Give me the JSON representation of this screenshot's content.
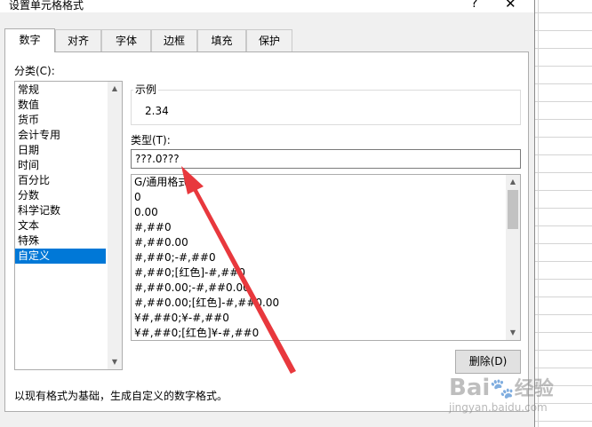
{
  "dialog": {
    "title": "设置单元格格式",
    "help_glyph": "?",
    "close_glyph": "✕"
  },
  "tabs": [
    {
      "label": "数字",
      "active": true
    },
    {
      "label": "对齐",
      "active": false
    },
    {
      "label": "字体",
      "active": false
    },
    {
      "label": "边框",
      "active": false
    },
    {
      "label": "填充",
      "active": false
    },
    {
      "label": "保护",
      "active": false
    }
  ],
  "category": {
    "label": "分类(C):",
    "items": [
      "常规",
      "数值",
      "货币",
      "会计专用",
      "日期",
      "时间",
      "百分比",
      "分数",
      "科学记数",
      "文本",
      "特殊",
      "自定义"
    ],
    "selected": "自定义"
  },
  "sample": {
    "label": "示例",
    "value": "2.34"
  },
  "type": {
    "label": "类型(T):",
    "value": "???.0???",
    "list": [
      "G/通用格式",
      "0",
      "0.00",
      "#,##0",
      "#,##0.00",
      "#,##0;-#,##0",
      "#,##0;[红色]-#,##0",
      "#,##0.00;-#,##0.00",
      "#,##0.00;[红色]-#,##0.00",
      "¥#,##0;¥-#,##0",
      "¥#,##0;[红色]¥-#,##0"
    ]
  },
  "delete_button": "删除(D)",
  "description": "以现有格式为基础，生成自定义的数字格式。",
  "watermark": {
    "brand": "Bai",
    "suffix": "经验",
    "url": "jingyan.baidu.com"
  },
  "colors": {
    "selection": "#0078d7",
    "annotation_arrow": "#e8383d"
  }
}
